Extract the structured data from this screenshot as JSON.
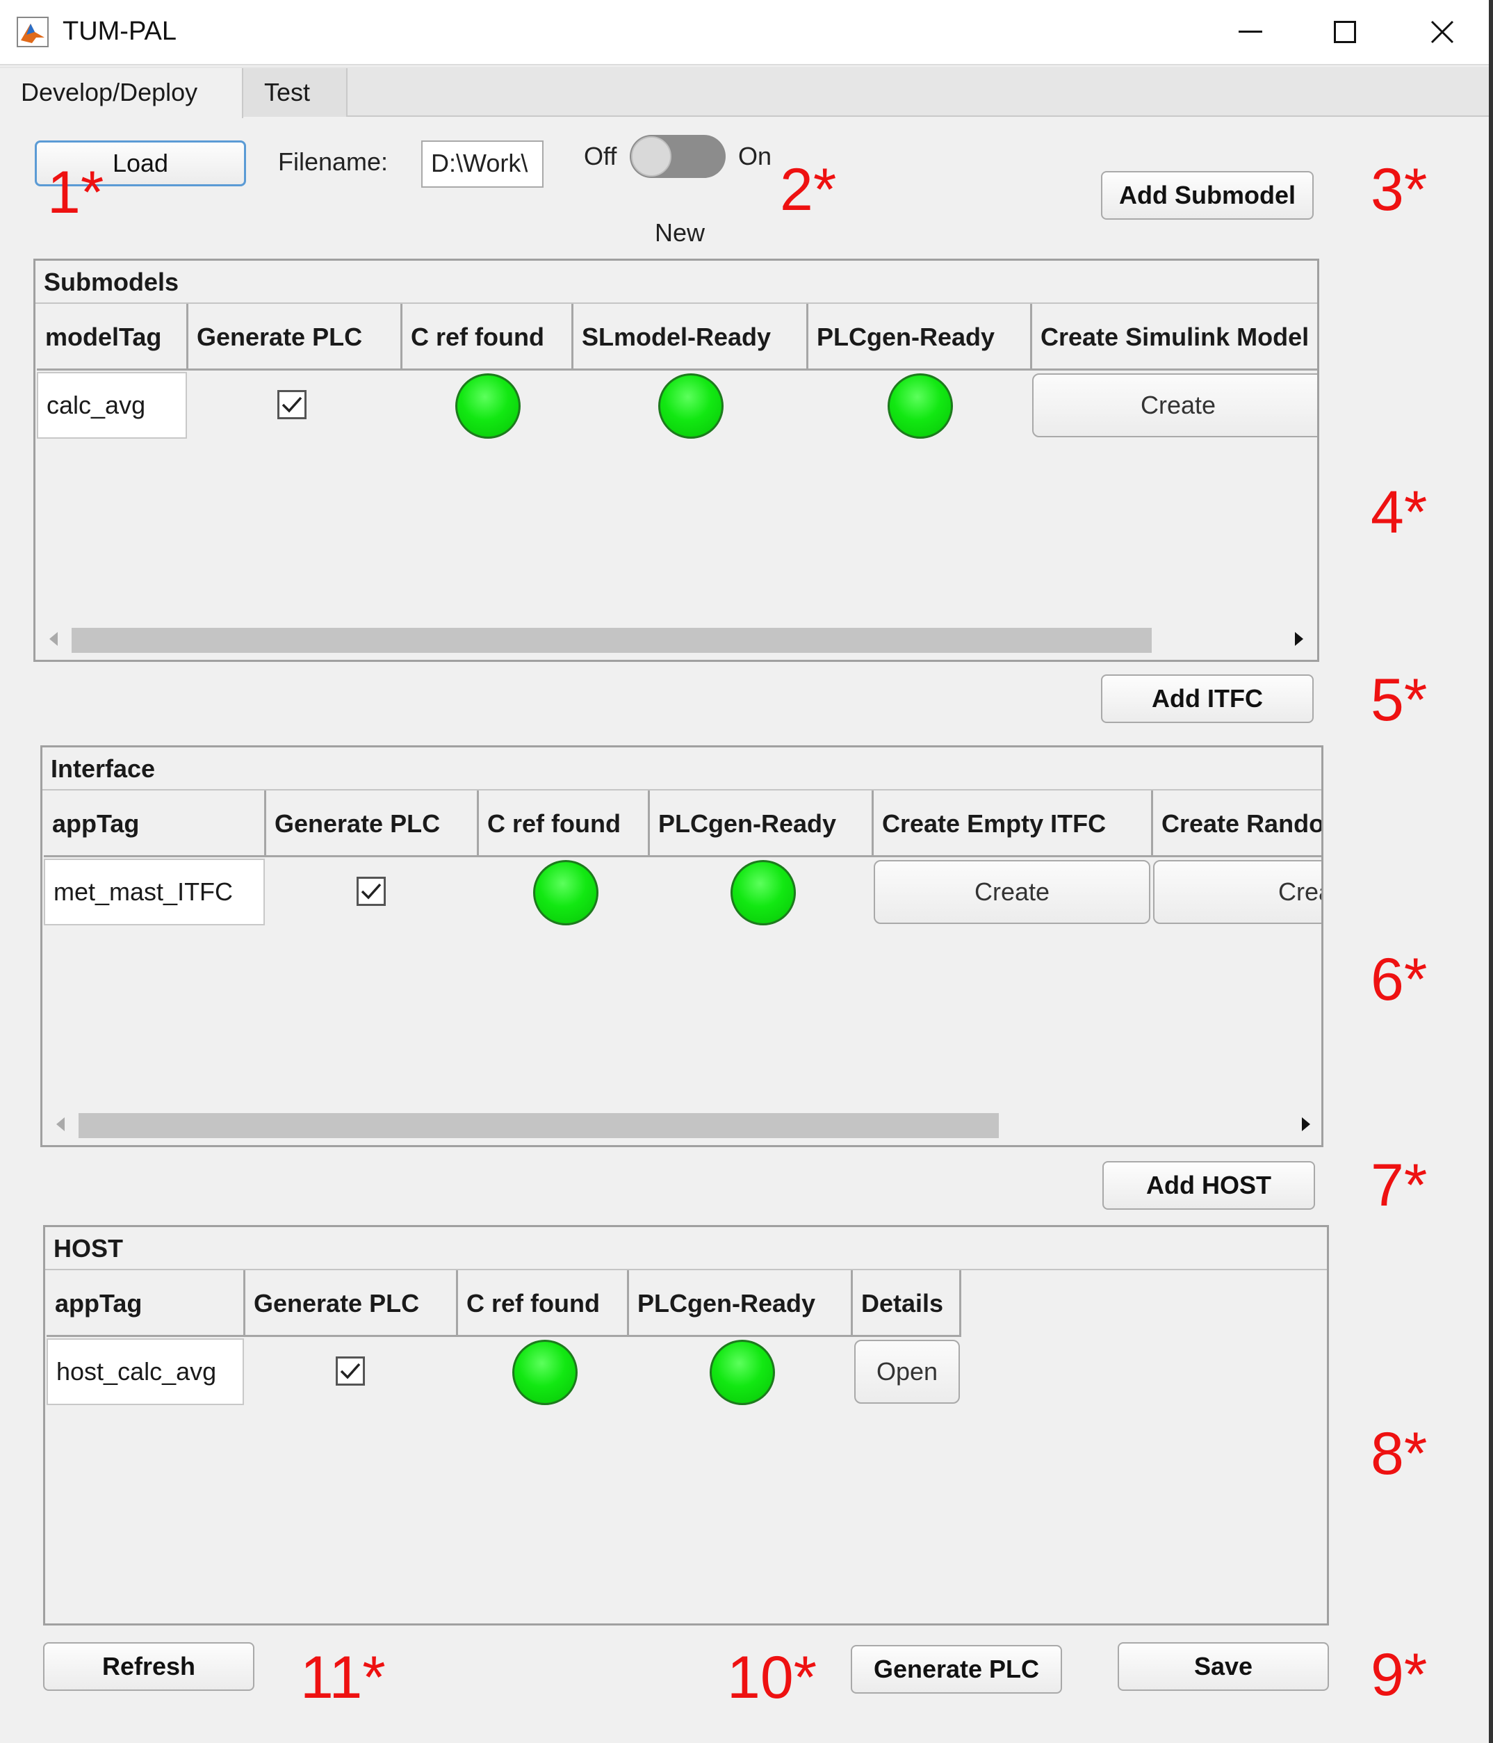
{
  "window": {
    "title": "TUM-PAL",
    "icon": "matlab-logo-icon",
    "controls": [
      "minimize-icon",
      "maximize-icon",
      "close-icon"
    ]
  },
  "tabs": [
    {
      "label": "Develop/Deploy",
      "active": true
    },
    {
      "label": "Test",
      "active": false
    }
  ],
  "top": {
    "load_label": "Load",
    "filename_label": "Filename:",
    "filename_value": "D:\\Work\\",
    "toggle_off": "Off",
    "toggle_on": "On",
    "toggle_state": "Off",
    "toggle_caption": "New",
    "add_submodel_label": "Add Submodel"
  },
  "submodels": {
    "title": "Submodels",
    "columns": [
      "modelTag",
      "Generate PLC",
      "C ref found",
      "SLmodel-Ready",
      "PLCgen-Ready",
      "Create Simulink Model"
    ],
    "rows": [
      {
        "modelTag": "calc_avg",
        "generate_plc": true,
        "c_ref_found": true,
        "slmodel_ready": true,
        "plcgen_ready": true,
        "create_label": "Create"
      }
    ]
  },
  "add_itfc_label": "Add ITFC",
  "interface": {
    "title": "Interface",
    "columns": [
      "appTag",
      "Generate PLC",
      "C ref found",
      "PLCgen-Ready",
      "Create Empty ITFC",
      "Create Rando"
    ],
    "rows": [
      {
        "appTag": "met_mast_ITFC",
        "generate_plc": true,
        "c_ref_found": true,
        "plcgen_ready": true,
        "create_empty_label": "Create",
        "create_random_label": "Crea"
      }
    ]
  },
  "add_host_label": "Add HOST",
  "host": {
    "title": "HOST",
    "columns": [
      "appTag",
      "Generate PLC",
      "C ref found",
      "PLCgen-Ready",
      "Details"
    ],
    "rows": [
      {
        "appTag": "host_calc_avg",
        "generate_plc": true,
        "c_ref_found": true,
        "plcgen_ready": true,
        "details_label": "Open"
      }
    ]
  },
  "bottom": {
    "refresh_label": "Refresh",
    "generate_plc_label": "Generate PLC",
    "save_label": "Save"
  },
  "annotations": [
    "1*",
    "2*",
    "3*",
    "4*",
    "5*",
    "6*",
    "7*",
    "8*",
    "9*",
    "10*",
    "11*"
  ],
  "colors": {
    "status_led": "#12e812",
    "annotation": "#ee1111",
    "focus_border": "#5b9bd5"
  }
}
